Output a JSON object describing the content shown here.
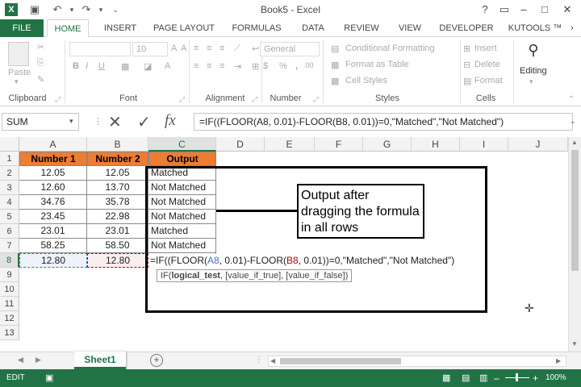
{
  "window": {
    "title": "Book5 - Excel",
    "help_icon": "?",
    "restore_icon": "□",
    "minimize_icon": "–",
    "close_icon": "✕"
  },
  "ribbon_tabs": [
    "FILE",
    "HOME",
    "INSERT",
    "PAGE LAYOUT",
    "FORMULAS",
    "DATA",
    "REVIEW",
    "VIEW",
    "DEVELOPER",
    "KUTOOLS ™"
  ],
  "ribbon": {
    "clipboard": {
      "label": "Clipboard",
      "paste": "Paste"
    },
    "font": {
      "label": "Font",
      "size": "10",
      "bold": "B",
      "italic": "I",
      "underline": "U"
    },
    "alignment": {
      "label": "Alignment"
    },
    "number": {
      "label": "Number",
      "format": "General",
      "currency": "$",
      "percent": "%",
      "comma": ","
    },
    "styles": {
      "label": "Styles",
      "conditional": "Conditional Formatting",
      "table": "Format as Table",
      "cell_styles": "Cell Styles"
    },
    "cells": {
      "label": "Cells",
      "insert": "Insert",
      "delete": "Delete",
      "format": "Format"
    },
    "editing": {
      "label": "Editing"
    }
  },
  "formula_bar": {
    "name_box": "SUM",
    "fx": "fx",
    "formula": "=IF((FLOOR(A8, 0.01)-FLOOR(B8, 0.01))=0,\"Matched\",\"Not Matched\")"
  },
  "grid": {
    "columns": [
      "A",
      "B",
      "C",
      "D",
      "E",
      "F",
      "G",
      "H",
      "I",
      "J"
    ],
    "rows": [
      "1",
      "2",
      "3",
      "4",
      "5",
      "6",
      "7",
      "8",
      "9",
      "10",
      "11",
      "12",
      "13"
    ],
    "headers": [
      "Number 1",
      "Number 2",
      "Output"
    ],
    "data": [
      [
        "12.05",
        "12.05",
        "Matched"
      ],
      [
        "12.60",
        "13.70",
        "Not Matched"
      ],
      [
        "34.76",
        "35.78",
        "Not Matched"
      ],
      [
        "23.45",
        "22.98",
        "Not Matched"
      ],
      [
        "23.01",
        "23.01",
        "Matched"
      ],
      [
        "58.25",
        "58.50",
        "Not Matched"
      ],
      [
        "12.80",
        "12.80",
        ""
      ]
    ],
    "edit_parts": [
      "=IF((FLOOR(",
      "A8",
      ", 0.01)-FLOOR(",
      "B8",
      ", 0.01))=0,\"Matched\",\"Not Matched\")"
    ],
    "tooltip": {
      "prefix": "IF(",
      "bold": "logical_test",
      "rest": ", [value_if_true], [value_if_false])"
    },
    "annotation": "Output after dragging the formula in all rows",
    "colors": {
      "a8_ref": "#4472c4",
      "b8_ref": "#c00000",
      "header_fill": "#ed7d31",
      "excel_green": "#217346"
    }
  },
  "sheet_tabs": {
    "active": "Sheet1",
    "add": "+"
  },
  "status": {
    "mode": "EDIT",
    "zoom": "100%",
    "minus": "–",
    "plus": "+"
  }
}
